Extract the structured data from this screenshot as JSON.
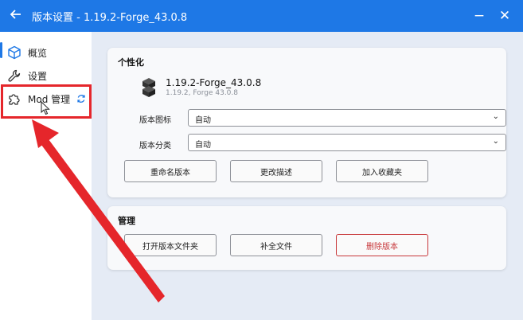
{
  "titlebar": {
    "back_icon": "arrow-left-icon",
    "title": "版本设置 - 1.19.2-Forge_43.0.8",
    "minimize_label": "−",
    "close_label": "✕"
  },
  "sidebar": {
    "items": [
      {
        "label": "概览",
        "icon": "cube-icon"
      },
      {
        "label": "设置",
        "icon": "wrench-icon"
      },
      {
        "label": "Mod 管理",
        "icon": "puzzle-icon"
      }
    ],
    "refresh_icon": "refresh-icon"
  },
  "personalize": {
    "title": "个性化",
    "version_name": "1.19.2-Forge_43.0.8",
    "version_sub": "1.19.2, Forge 43.0.8",
    "icon_label": "版本图标",
    "icon_value": "自动",
    "category_label": "版本分类",
    "category_value": "自动",
    "buttons": [
      "重命名版本",
      "更改描述",
      "加入收藏夹"
    ]
  },
  "manage": {
    "title": "管理",
    "buttons": [
      "打开版本文件夹",
      "补全文件",
      "删除版本"
    ]
  },
  "colors": {
    "accent": "#1e78e6",
    "annotation": "#e5262b",
    "danger": "#c7373a"
  }
}
